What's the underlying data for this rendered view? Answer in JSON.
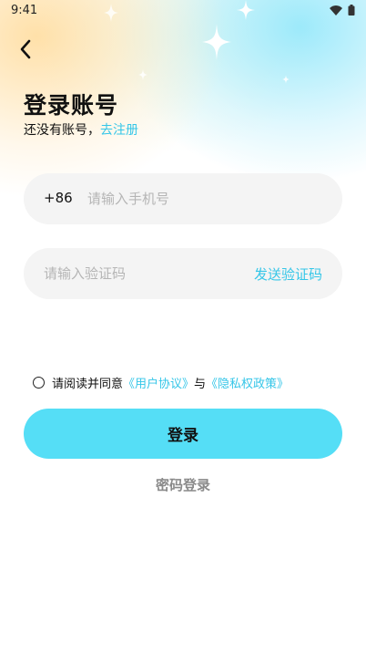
{
  "status_bar": {
    "time": "9:41"
  },
  "header": {
    "title": "登录账号",
    "subtitle_prefix": "还没有账号，",
    "register_link": "去注册"
  },
  "phone_field": {
    "country_code": "+86",
    "placeholder": "请输入手机号",
    "value": ""
  },
  "code_field": {
    "placeholder": "请输入验证码",
    "value": "",
    "send_code_label": "发送验证码"
  },
  "agreement": {
    "prefix": "请阅读并同意",
    "user_agreement": "《用户协议》",
    "conjunction": "与",
    "privacy_policy": "《隐私权政策》"
  },
  "login_button": "登录",
  "password_login": "密码登录",
  "colors": {
    "accent": "#55def6",
    "link": "#35c6e8"
  }
}
